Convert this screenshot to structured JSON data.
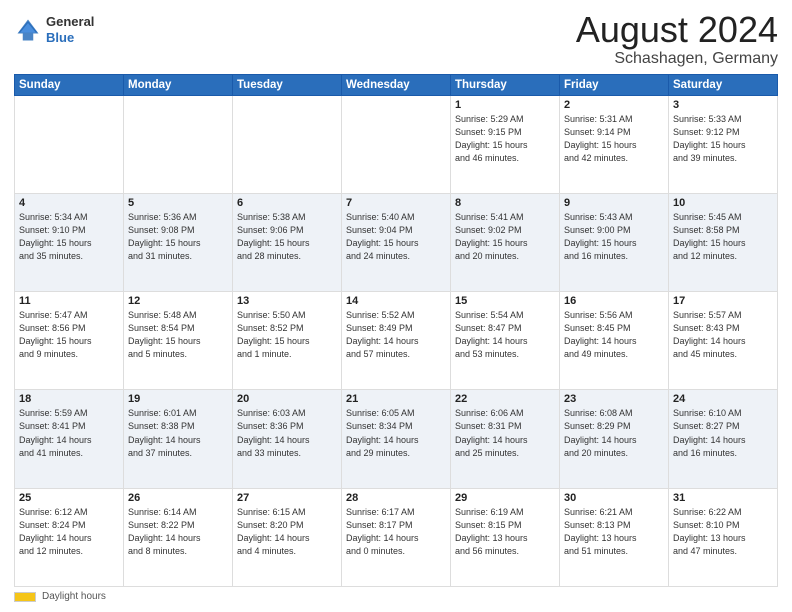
{
  "header": {
    "logo": {
      "general": "General",
      "blue": "Blue"
    },
    "title": "August 2024",
    "subtitle": "Schashagen, Germany"
  },
  "days_of_week": [
    "Sunday",
    "Monday",
    "Tuesday",
    "Wednesday",
    "Thursday",
    "Friday",
    "Saturday"
  ],
  "weeks": [
    [
      {
        "day": "",
        "info": ""
      },
      {
        "day": "",
        "info": ""
      },
      {
        "day": "",
        "info": ""
      },
      {
        "day": "",
        "info": ""
      },
      {
        "day": "1",
        "info": "Sunrise: 5:29 AM\nSunset: 9:15 PM\nDaylight: 15 hours\nand 46 minutes."
      },
      {
        "day": "2",
        "info": "Sunrise: 5:31 AM\nSunset: 9:14 PM\nDaylight: 15 hours\nand 42 minutes."
      },
      {
        "day": "3",
        "info": "Sunrise: 5:33 AM\nSunset: 9:12 PM\nDaylight: 15 hours\nand 39 minutes."
      }
    ],
    [
      {
        "day": "4",
        "info": "Sunrise: 5:34 AM\nSunset: 9:10 PM\nDaylight: 15 hours\nand 35 minutes."
      },
      {
        "day": "5",
        "info": "Sunrise: 5:36 AM\nSunset: 9:08 PM\nDaylight: 15 hours\nand 31 minutes."
      },
      {
        "day": "6",
        "info": "Sunrise: 5:38 AM\nSunset: 9:06 PM\nDaylight: 15 hours\nand 28 minutes."
      },
      {
        "day": "7",
        "info": "Sunrise: 5:40 AM\nSunset: 9:04 PM\nDaylight: 15 hours\nand 24 minutes."
      },
      {
        "day": "8",
        "info": "Sunrise: 5:41 AM\nSunset: 9:02 PM\nDaylight: 15 hours\nand 20 minutes."
      },
      {
        "day": "9",
        "info": "Sunrise: 5:43 AM\nSunset: 9:00 PM\nDaylight: 15 hours\nand 16 minutes."
      },
      {
        "day": "10",
        "info": "Sunrise: 5:45 AM\nSunset: 8:58 PM\nDaylight: 15 hours\nand 12 minutes."
      }
    ],
    [
      {
        "day": "11",
        "info": "Sunrise: 5:47 AM\nSunset: 8:56 PM\nDaylight: 15 hours\nand 9 minutes."
      },
      {
        "day": "12",
        "info": "Sunrise: 5:48 AM\nSunset: 8:54 PM\nDaylight: 15 hours\nand 5 minutes."
      },
      {
        "day": "13",
        "info": "Sunrise: 5:50 AM\nSunset: 8:52 PM\nDaylight: 15 hours\nand 1 minute."
      },
      {
        "day": "14",
        "info": "Sunrise: 5:52 AM\nSunset: 8:49 PM\nDaylight: 14 hours\nand 57 minutes."
      },
      {
        "day": "15",
        "info": "Sunrise: 5:54 AM\nSunset: 8:47 PM\nDaylight: 14 hours\nand 53 minutes."
      },
      {
        "day": "16",
        "info": "Sunrise: 5:56 AM\nSunset: 8:45 PM\nDaylight: 14 hours\nand 49 minutes."
      },
      {
        "day": "17",
        "info": "Sunrise: 5:57 AM\nSunset: 8:43 PM\nDaylight: 14 hours\nand 45 minutes."
      }
    ],
    [
      {
        "day": "18",
        "info": "Sunrise: 5:59 AM\nSunset: 8:41 PM\nDaylight: 14 hours\nand 41 minutes."
      },
      {
        "day": "19",
        "info": "Sunrise: 6:01 AM\nSunset: 8:38 PM\nDaylight: 14 hours\nand 37 minutes."
      },
      {
        "day": "20",
        "info": "Sunrise: 6:03 AM\nSunset: 8:36 PM\nDaylight: 14 hours\nand 33 minutes."
      },
      {
        "day": "21",
        "info": "Sunrise: 6:05 AM\nSunset: 8:34 PM\nDaylight: 14 hours\nand 29 minutes."
      },
      {
        "day": "22",
        "info": "Sunrise: 6:06 AM\nSunset: 8:31 PM\nDaylight: 14 hours\nand 25 minutes."
      },
      {
        "day": "23",
        "info": "Sunrise: 6:08 AM\nSunset: 8:29 PM\nDaylight: 14 hours\nand 20 minutes."
      },
      {
        "day": "24",
        "info": "Sunrise: 6:10 AM\nSunset: 8:27 PM\nDaylight: 14 hours\nand 16 minutes."
      }
    ],
    [
      {
        "day": "25",
        "info": "Sunrise: 6:12 AM\nSunset: 8:24 PM\nDaylight: 14 hours\nand 12 minutes."
      },
      {
        "day": "26",
        "info": "Sunrise: 6:14 AM\nSunset: 8:22 PM\nDaylight: 14 hours\nand 8 minutes."
      },
      {
        "day": "27",
        "info": "Sunrise: 6:15 AM\nSunset: 8:20 PM\nDaylight: 14 hours\nand 4 minutes."
      },
      {
        "day": "28",
        "info": "Sunrise: 6:17 AM\nSunset: 8:17 PM\nDaylight: 14 hours\nand 0 minutes."
      },
      {
        "day": "29",
        "info": "Sunrise: 6:19 AM\nSunset: 8:15 PM\nDaylight: 13 hours\nand 56 minutes."
      },
      {
        "day": "30",
        "info": "Sunrise: 6:21 AM\nSunset: 8:13 PM\nDaylight: 13 hours\nand 51 minutes."
      },
      {
        "day": "31",
        "info": "Sunrise: 6:22 AM\nSunset: 8:10 PM\nDaylight: 13 hours\nand 47 minutes."
      }
    ]
  ],
  "footer": {
    "daylight_label": "Daylight hours"
  }
}
